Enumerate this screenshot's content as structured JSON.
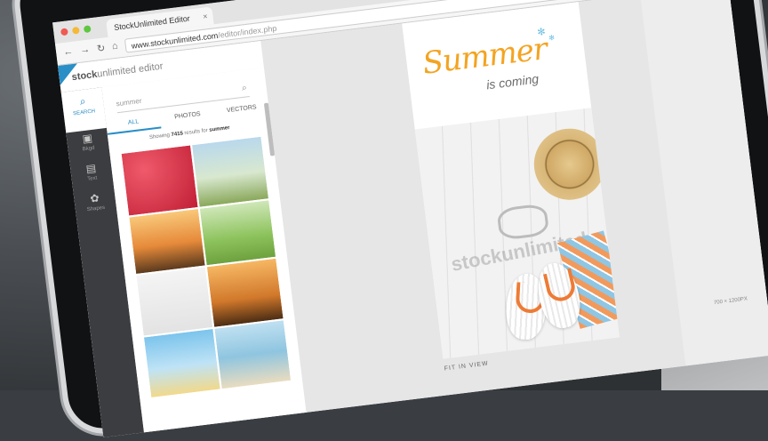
{
  "browser": {
    "tab_title": "StockUnlimited Editor",
    "tab_close": "×",
    "url_host": "www.stockunlimited.com",
    "url_path": "/editor/index.php"
  },
  "app": {
    "logo_bold": "stock",
    "logo_rest": "unlimited",
    "logo_suffix": " editor",
    "rail": [
      {
        "label": "SEARCH",
        "icon": "search-icon"
      },
      {
        "label": "Bkgd",
        "icon": "image-icon"
      },
      {
        "label": "Text",
        "icon": "text-icon"
      },
      {
        "label": "Shapes",
        "icon": "shapes-icon"
      }
    ],
    "search": {
      "value": "summer",
      "icon": "magnifier-icon"
    },
    "type_tabs": [
      "ALL",
      "PHOTOS",
      "VECTORS"
    ],
    "results_prefix": "Showing ",
    "results_count": "7415",
    "results_mid": " results for ",
    "results_term": "summer"
  },
  "poster": {
    "headline": "Summer",
    "subline": "is coming",
    "watermark": "stockunlimited"
  },
  "status": {
    "zoom": "FIT IN VIEW",
    "size": "700 × 1200PX"
  },
  "colors": {
    "accent": "#2a8ec7",
    "headline": "#f3a421"
  }
}
